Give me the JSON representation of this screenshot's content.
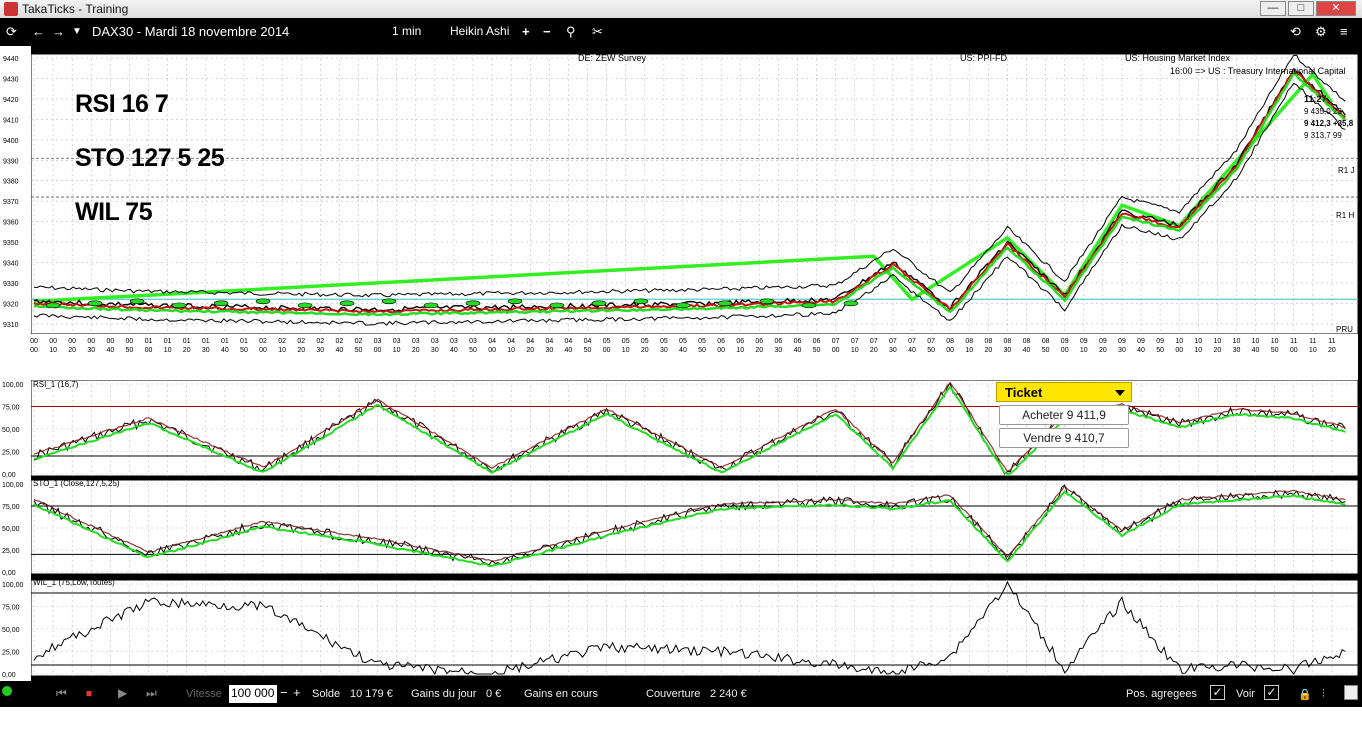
{
  "window": {
    "title": "TakaTicks - Training",
    "minimize": "—",
    "maximize": "□",
    "close": "✕"
  },
  "toolbar": {
    "refresh": "⟳",
    "back": "←",
    "forward": "→",
    "dropdown": "▼",
    "symbol_date": "DAX30 - Mardi 18 novembre 2014",
    "interval": "1 min",
    "chart_type": "Heikin Ashi",
    "zoom_in": "+",
    "zoom_out": "−",
    "right_icons": [
      "⟲",
      "☺",
      "≡"
    ]
  },
  "chart": {
    "annotations": [
      "RSI 16 7",
      "STO 127  5  25",
      "WIL 75"
    ],
    "events": [
      {
        "label": "DE: ZEW Survey"
      },
      {
        "label": "US: PPI-FD"
      },
      {
        "label": "US: Housing Market Index"
      },
      {
        "label": "16:00 => US : Treasury International Capital"
      }
    ],
    "level_labels": [
      "R1 J",
      "R1 H",
      "PRU"
    ],
    "last_time": "11:27",
    "price_readouts": [
      "9 435,0  23",
      "9 412,3 +35,8",
      "9 313,7  99"
    ],
    "panels": [
      {
        "name": "RSI_1 (16,7)",
        "ylabels": [
          "100,00",
          "75,00",
          "50,00",
          "25,00",
          "0,00"
        ]
      },
      {
        "name": "STO_1 (Close,127,5,25)",
        "ylabels": [
          "100,00",
          "75,00",
          "50,00",
          "25,00",
          "0,00"
        ]
      },
      {
        "name": "WIL_1 (75,Low,Toutes)",
        "ylabels": [
          "100,00",
          "75,00",
          "50,00",
          "25,00",
          "0,00"
        ]
      }
    ],
    "xlabels_top": [
      "00",
      "00",
      "00",
      "00",
      "00",
      "00",
      "01",
      "01",
      "01",
      "01",
      "01",
      "01",
      "02",
      "02",
      "02",
      "02",
      "02",
      "02",
      "03",
      "03",
      "03",
      "03",
      "03",
      "03",
      "04",
      "04",
      "04",
      "04",
      "04",
      "04",
      "05",
      "05",
      "05",
      "05",
      "05",
      "05",
      "06",
      "06",
      "06",
      "06",
      "06",
      "06",
      "07",
      "07",
      "07",
      "07",
      "07",
      "07",
      "08",
      "08",
      "08",
      "08",
      "08",
      "08",
      "09",
      "09",
      "09",
      "09",
      "09",
      "09",
      "10",
      "10",
      "10",
      "10",
      "10",
      "10",
      "11",
      "11",
      "11"
    ],
    "xlabels_bot": [
      "00",
      "10",
      "20",
      "30",
      "40",
      "50",
      "00",
      "10",
      "20",
      "30",
      "40",
      "50",
      "00",
      "10",
      "20",
      "30",
      "40",
      "50",
      "00",
      "10",
      "20",
      "30",
      "40",
      "50",
      "00",
      "10",
      "20",
      "30",
      "40",
      "50",
      "00",
      "10",
      "20",
      "30",
      "40",
      "50",
      "00",
      "10",
      "20",
      "30",
      "40",
      "50",
      "00",
      "10",
      "20",
      "30",
      "40",
      "50",
      "00",
      "10",
      "20",
      "30",
      "40",
      "50",
      "00",
      "10",
      "20",
      "30",
      "40",
      "50",
      "00",
      "10",
      "20",
      "30",
      "40",
      "50",
      "00",
      "10",
      "20"
    ],
    "colors": {
      "price_line": "#000000",
      "trend_line": "#33ee22",
      "red_ma": "#cc1111",
      "green_ma": "#22dd22",
      "pru_line": "#55cccc"
    }
  },
  "chart_data": {
    "type": "line",
    "title": "DAX30 - Mardi 18 novembre 2014",
    "y_main": [
      9310,
      9320,
      9330,
      9340,
      9350,
      9360,
      9370,
      9380,
      9390,
      9400,
      9410,
      9420,
      9430,
      9440
    ],
    "ylim": [
      9305,
      9442
    ],
    "x_times": [
      "00:00",
      "01:00",
      "02:00",
      "03:00",
      "04:00",
      "05:00",
      "06:00",
      "07:00",
      "07:30",
      "08:00",
      "08:30",
      "09:00",
      "09:30",
      "10:00",
      "10:30",
      "11:00",
      "11:27"
    ],
    "price": [
      9321,
      9319,
      9318,
      9317,
      9318,
      9319,
      9320,
      9322,
      9340,
      9318,
      9350,
      9324,
      9365,
      9358,
      9388,
      9435,
      9412
    ],
    "levels": {
      "R1 J": 9391,
      "R1 H": 9372,
      "PRU": 9322
    },
    "series": [
      {
        "name": "RSI_1 (16,7)",
        "values": [
          20,
          60,
          5,
          80,
          5,
          70,
          5,
          70,
          10,
          100,
          0,
          65,
          75,
          55,
          70,
          65,
          50
        ]
      },
      {
        "name": "STO_1 (Close,127,5,25)",
        "values": [
          80,
          20,
          55,
          35,
          10,
          45,
          75,
          80,
          75,
          85,
          15,
          95,
          45,
          80,
          85,
          90,
          80
        ]
      },
      {
        "name": "WIL_1 (75,Low,Toutes)",
        "values": [
          20,
          80,
          75,
          10,
          0,
          30,
          25,
          10,
          0,
          20,
          100,
          5,
          80,
          5,
          10,
          5,
          25
        ]
      }
    ]
  },
  "ticket": {
    "title": "Ticket",
    "buy": "Acheter 9 411,9",
    "sell": "Vendre 9 410,7"
  },
  "status": {
    "rewind": "⏮",
    "stop": "⏹",
    "play": "▶",
    "step": "⏭",
    "speed_label": "Vitesse",
    "amount": "100 000",
    "minus": "−",
    "plus": "+",
    "solde_label": "Solde",
    "solde_value": "10 179 €",
    "gains_jour_label": "Gains du jour",
    "gains_jour_value": "0 €",
    "gains_cours_label": "Gains en cours",
    "couverture_label": "Couverture",
    "couverture_value": "2 240 €",
    "pos_agregees_label": "Pos. agregees",
    "voir_label": "Voir"
  }
}
